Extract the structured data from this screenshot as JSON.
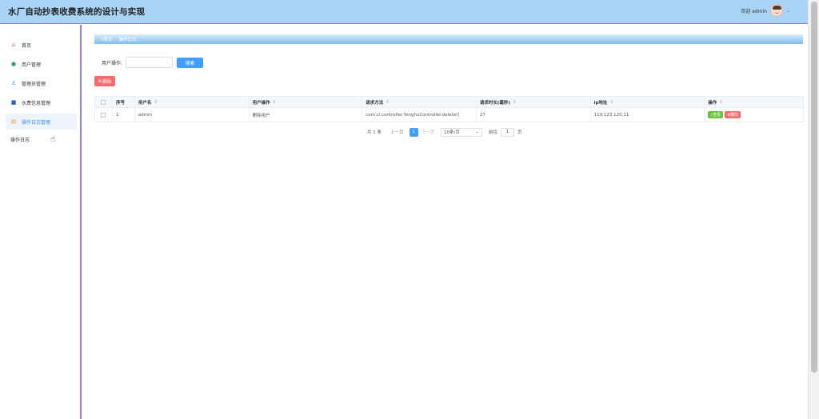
{
  "header": {
    "app_title": "水厂自动抄表收费系统的设计与实现",
    "welcome": "欢迎 admin",
    "bg_color": "#a9d4f5"
  },
  "sidebar": {
    "items": [
      {
        "label": "首页",
        "icon": "home-icon"
      },
      {
        "label": "用户管理",
        "icon": "user-icon"
      },
      {
        "label": "管理员管理",
        "icon": "admin-icon"
      },
      {
        "label": "水费信息管理",
        "icon": "book-icon"
      },
      {
        "label": "操作日志管理",
        "icon": "log-icon"
      }
    ],
    "sub_item": "操作日志"
  },
  "breadcrumb": {
    "home": "首页",
    "separator": "-",
    "current": "操作日志"
  },
  "search": {
    "label": "用户操作:",
    "value": "",
    "button": "搜索"
  },
  "actions": {
    "delete": "删除"
  },
  "table": {
    "columns": [
      "序号",
      "用户名",
      "用户操作",
      "请求方法",
      "请求时长(毫秒)",
      "ip地址",
      "操作"
    ],
    "rows": [
      {
        "index": "1",
        "username": "admin",
        "operation": "删除用户",
        "method": "com.cl.controller.YonghuController.delete()",
        "duration": "27",
        "ip": "119.123.120.11",
        "view": "查看",
        "delete": "删除"
      }
    ]
  },
  "pagination": {
    "total": "共 1 条",
    "prev": "上一页",
    "current": "1",
    "next": "下一页",
    "page_size": "10条/页",
    "goto": "前往",
    "page_input": "1",
    "page_unit": "页"
  },
  "colors": {
    "primary": "#409eff",
    "danger": "#f56c6c",
    "success": "#67c23a",
    "sidebar_border": "#9a7fd0"
  }
}
